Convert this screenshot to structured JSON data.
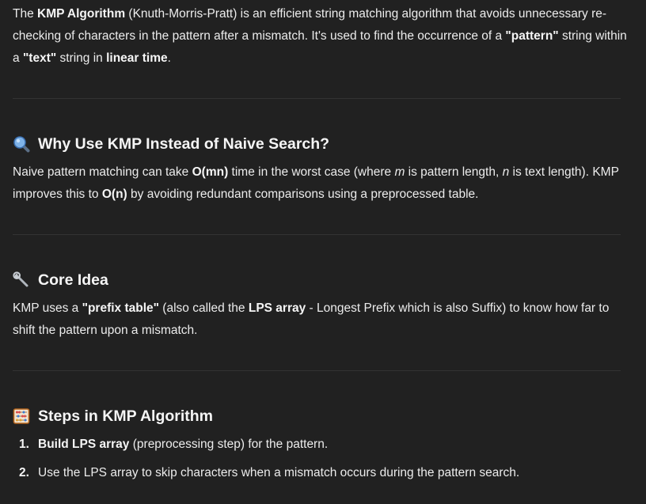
{
  "intro": {
    "t1": "The ",
    "b1": "KMP Algorithm",
    "t2": " (Knuth-Morris-Pratt) is an efficient string matching algorithm that avoids unnecessary re-checking of characters in the pattern after a mismatch. It's used to find the occurrence of a ",
    "b2": "\"pattern\"",
    "t3": " string within a ",
    "b3": "\"text\"",
    "t4": " string in ",
    "b4": "linear time",
    "t5": "."
  },
  "why": {
    "icon": "magnifying-glass-icon",
    "heading": "Why Use KMP Instead of Naive Search?",
    "t1": "Naive pattern matching can take ",
    "b1": "O(mn)",
    "t2": " time in the worst case (where ",
    "i1": "m",
    "t3": " is pattern length, ",
    "i2": "n",
    "t4": " is text length). KMP improves this to ",
    "b2": "O(n)",
    "t5": " by avoiding redundant comparisons using a preprocessed table."
  },
  "core": {
    "icon": "wrench-icon",
    "heading": "Core Idea",
    "t1": "KMP uses a ",
    "b1": "\"prefix table\"",
    "t2": " (also called the ",
    "b2": "LPS array",
    "t3": " - Longest Prefix which is also Suffix) to know how far to shift the pattern upon a mismatch."
  },
  "steps": {
    "icon": "abacus-icon",
    "heading": "Steps in KMP Algorithm",
    "items": [
      {
        "num": "1.",
        "bold": "Build LPS array",
        "text": " (preprocessing step) for the pattern."
      },
      {
        "num": "2.",
        "bold": "",
        "text": "Use the LPS array to skip characters when a mismatch occurs during the pattern search."
      }
    ]
  },
  "colors": {
    "background": "#212121",
    "text": "#ececec",
    "divider": "#333333"
  }
}
